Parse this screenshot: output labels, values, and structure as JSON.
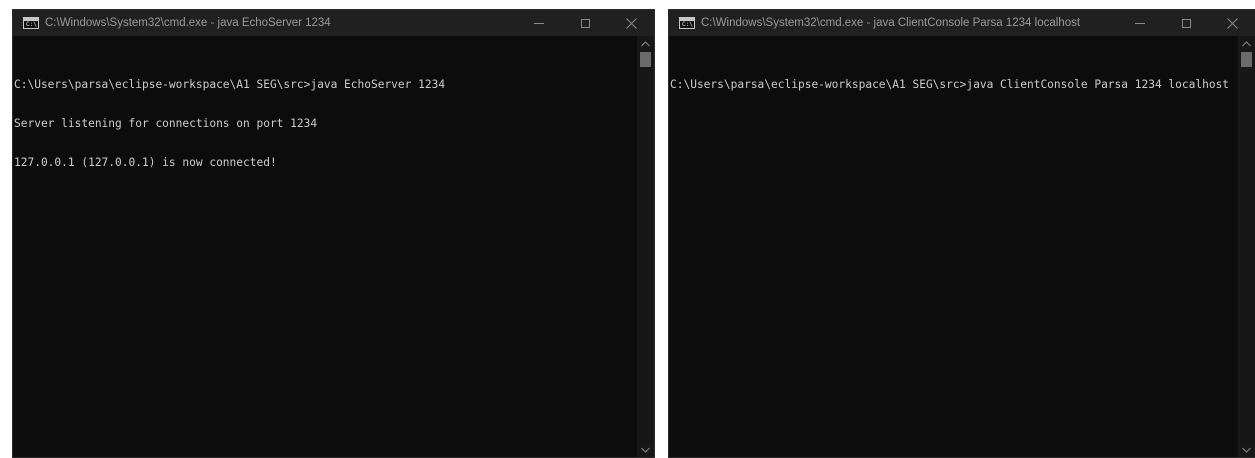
{
  "windows": [
    {
      "title": "C:\\Windows\\System32\\cmd.exe - java  EchoServer 1234",
      "lines": [
        "C:\\Users\\parsa\\eclipse-workspace\\A1 SEG\\src>java EchoServer 1234",
        "Server listening for connections on port 1234",
        "127.0.0.1 (127.0.0.1) is now connected!"
      ]
    },
    {
      "title": "C:\\Windows\\System32\\cmd.exe - java  ClientConsole Parsa 1234 localhost",
      "lines": [
        "C:\\Users\\parsa\\eclipse-workspace\\A1 SEG\\src>java ClientConsole Parsa 1234 localhost"
      ]
    }
  ],
  "icons": {
    "app": "cmd-icon",
    "minimize": "minimize-icon",
    "maximize": "maximize-icon",
    "close": "close-icon",
    "scroll_up": "chevron-up-icon",
    "scroll_down": "chevron-down-icon"
  },
  "colors": {
    "console_bg": "#0c0c0c",
    "console_text": "#cccccc",
    "titlebar_bg": "#202020",
    "title_text": "#9a9a9a"
  }
}
